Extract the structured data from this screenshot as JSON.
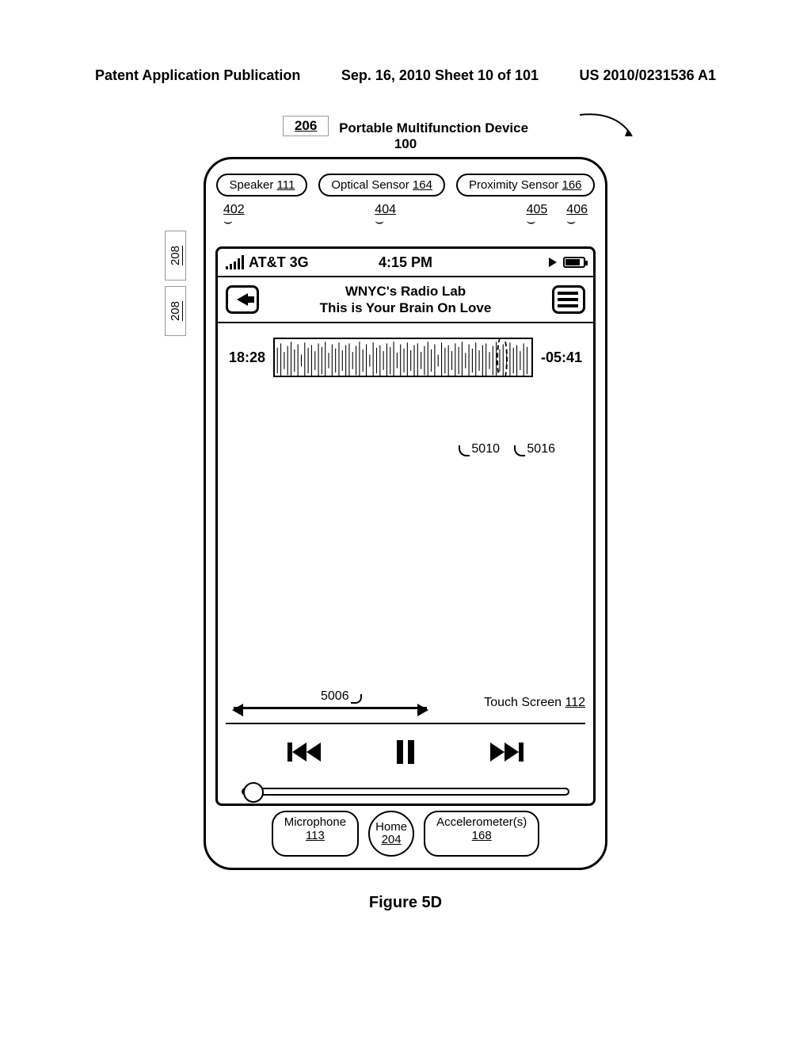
{
  "header": {
    "left": "Patent Application Publication",
    "center": "Sep. 16, 2010  Sheet 10 of 101",
    "right": "US 2010/0231536 A1"
  },
  "figure": {
    "title": "Portable Multifunction Device",
    "device_num": "100",
    "ref_206": "206",
    "ref_208": "208",
    "caption": "Figure 5D"
  },
  "sensors_top": {
    "speaker": {
      "label": "Speaker",
      "num": "111"
    },
    "optical": {
      "label": "Optical Sensor",
      "num": "164"
    },
    "proximity": {
      "label": "Proximity Sensor",
      "num": "166"
    }
  },
  "sensors_bottom": {
    "mic": {
      "label": "Microphone",
      "num": "113"
    },
    "home": {
      "label": "Home",
      "num": "204"
    },
    "accel": {
      "label": "Accelerometer(s)",
      "num": "168"
    }
  },
  "refs": {
    "r402": "402",
    "r404": "404",
    "r405": "405",
    "r406": "406",
    "r5006": "5006",
    "r5010": "5010",
    "r5016": "5016"
  },
  "touch_screen": {
    "label": "Touch Screen",
    "num": "112"
  },
  "status": {
    "carrier": "AT&T 3G",
    "time": "4:15 PM"
  },
  "nav": {
    "line1": "WNYC's Radio Lab",
    "line2": "This is Your Brain On Love"
  },
  "scrub": {
    "elapsed": "18:28",
    "remaining": "-05:41"
  }
}
